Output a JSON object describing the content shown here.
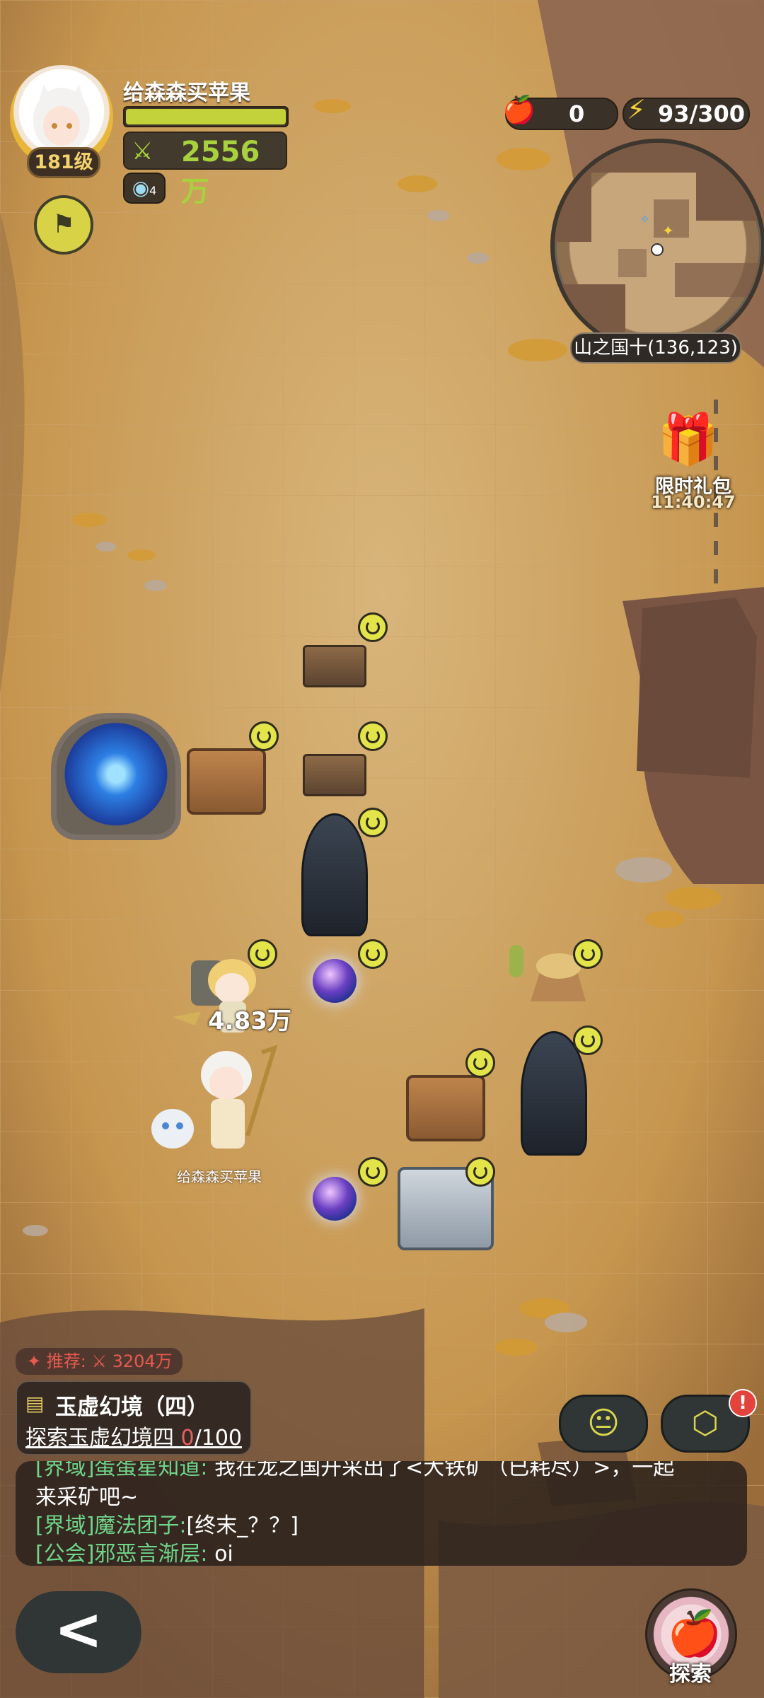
{
  "player": {
    "name": "给森森买苹果",
    "level": "181级",
    "power": "2556万",
    "power_icon": "crossed-swords-icon",
    "hp_percent": 100,
    "buff_count": "4"
  },
  "resources": {
    "apples": "0",
    "energy": "93/300"
  },
  "map": {
    "location": "山之国十(136,123)"
  },
  "gift": {
    "label": "限时礼包",
    "timer": "11:40:47"
  },
  "battle": {
    "damage": "4.83万",
    "character_name": "给森森买苹果"
  },
  "quest": {
    "recommend": "✦ 推荐: ⚔ 3204万",
    "title": "玉虚幻境（四）",
    "progress_prefix": "探索玉虚幻境四 ",
    "progress_current": "0",
    "progress_total": "/100"
  },
  "chat": [
    {
      "channel": "[界域]",
      "sender": "蛋蛋星知道:",
      "text": "我在龙之国开采出了<大铁矿（已耗尽）>，一起"
    },
    {
      "channel": "",
      "sender": "",
      "text": "来采矿吧~"
    },
    {
      "channel": "[界域]",
      "sender": "魔法团子:",
      "text": "[终末_？？]"
    },
    {
      "channel": "[公会]",
      "sender": "邪恶言渐层:",
      "text": "oi"
    }
  ],
  "buttons": {
    "back": "<",
    "explore": "探索",
    "alert": "!"
  },
  "colors": {
    "power": "#a8d13e",
    "chat_channel": "#6fd58a",
    "alert": "#e2433c"
  }
}
